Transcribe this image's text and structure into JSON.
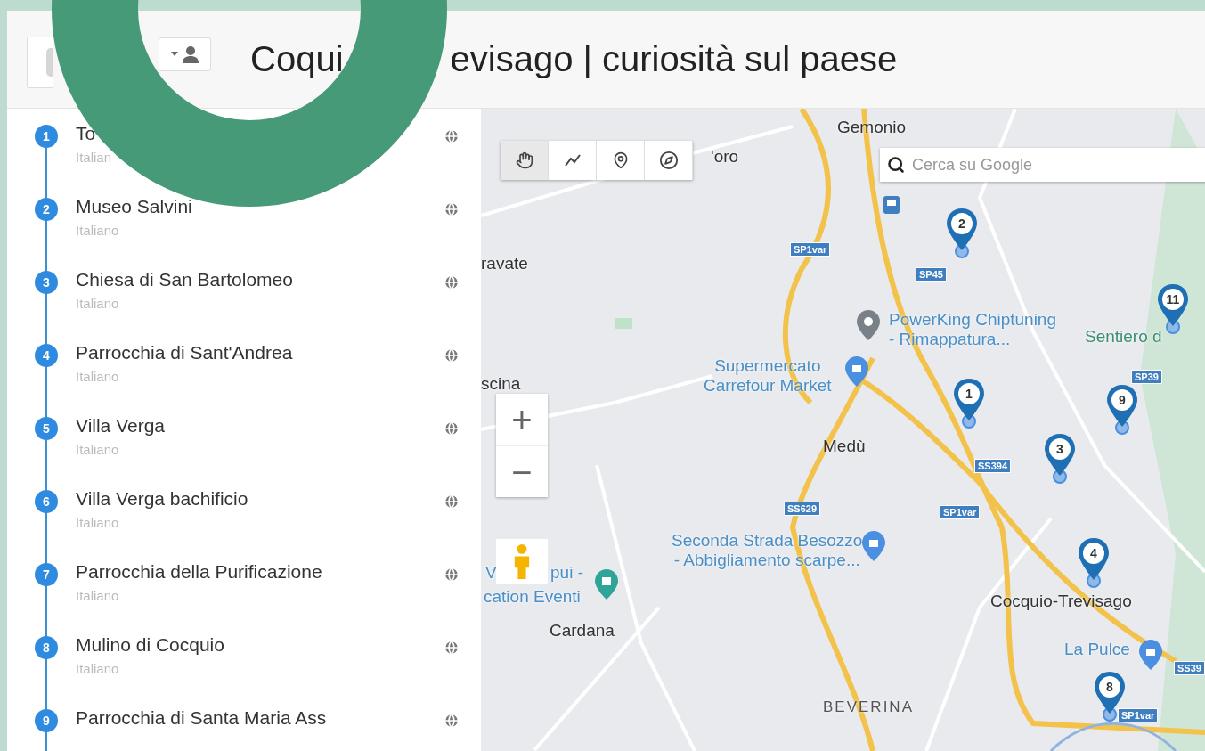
{
  "header": {
    "title_parts": [
      "Coqui",
      "evisago | curiosità sul paese"
    ]
  },
  "places": [
    {
      "number": "1",
      "name": "To",
      "language": "Italian"
    },
    {
      "number": "2",
      "name": "Museo Salvini",
      "language": "Italiano"
    },
    {
      "number": "3",
      "name": "Chiesa di San Bartolomeo",
      "language": "Italiano"
    },
    {
      "number": "4",
      "name": "Parrocchia di Sant'Andrea",
      "language": "Italiano"
    },
    {
      "number": "5",
      "name": "Villa Verga",
      "language": "Italiano"
    },
    {
      "number": "6",
      "name": "Villa Verga bachificio",
      "language": "Italiano"
    },
    {
      "number": "7",
      "name": "Parrocchia della Purificazione",
      "language": "Italiano"
    },
    {
      "number": "8",
      "name": "Mulino di Cocquio",
      "language": "Italiano"
    },
    {
      "number": "9",
      "name": "Parrocchia di Santa Maria Ass"
    }
  ],
  "map": {
    "tools": [
      {
        "kind": "hand",
        "selected": true
      },
      {
        "kind": "line",
        "selected": false
      },
      {
        "kind": "pin",
        "selected": false
      },
      {
        "kind": "compass",
        "selected": false
      }
    ],
    "search": {
      "placeholder": "Cerca su Google"
    },
    "zoom": {
      "in": "+",
      "out": "−"
    },
    "labels": [
      {
        "kind": "place",
        "text": "Gemonio"
      },
      {
        "kind": "place",
        "text": "'oro"
      },
      {
        "kind": "place",
        "text": "ravate"
      },
      {
        "kind": "place",
        "text": "scina"
      },
      {
        "kind": "poi-pin",
        "text": "PowerKing Chiptuning\n- Rimappatura..."
      },
      {
        "kind": "poi-shop",
        "text": "Supermercato\nCarrefour Market"
      },
      {
        "kind": "place",
        "text": "Medù"
      },
      {
        "kind": "poi-shop",
        "text": "Seconda Strada Besozzo\n- Abbigliamento scarpe..."
      },
      {
        "kind": "poi",
        "text": "V"
      },
      {
        "kind": "poi",
        "text": "pui -"
      },
      {
        "kind": "poi-venue",
        "text": "cation Eventi"
      },
      {
        "kind": "place",
        "text": "Cardana"
      },
      {
        "kind": "place",
        "text": "Cocquio-Trevisago"
      },
      {
        "kind": "poi-shop",
        "text": "La Pulce"
      },
      {
        "kind": "district",
        "text": "BEVERINA"
      },
      {
        "kind": "park",
        "text": "Sentiero d"
      }
    ],
    "roads": [
      "SP1var",
      "SP45",
      "SS394",
      "SS629",
      "SP1var",
      "SP39",
      "SS39",
      "SP1var"
    ],
    "pins": [
      "2",
      "11",
      "1",
      "9",
      "3",
      "4",
      "8"
    ]
  }
}
